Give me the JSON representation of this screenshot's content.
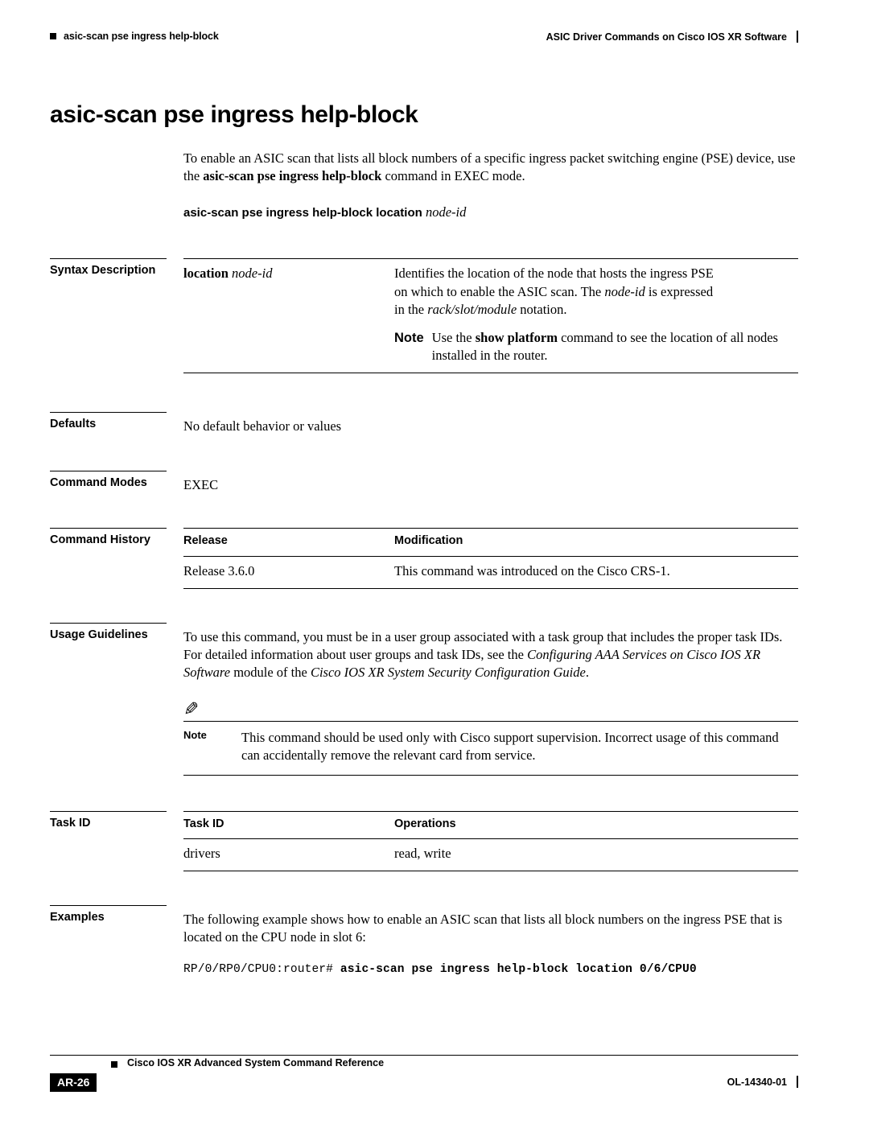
{
  "header": {
    "left_text": "asic-scan pse ingress help-block",
    "right_text": "ASIC Driver Commands on Cisco IOS XR Software"
  },
  "title": "asic-scan pse ingress help-block",
  "intro": {
    "part1": "To enable an ASIC scan that lists all block numbers of a specific ingress packet switching engine (PSE) device, use the ",
    "command_bold": "asic-scan pse ingress help-block",
    "part2": " command in EXEC mode."
  },
  "command_syntax": {
    "command": "asic-scan pse ingress help-block location",
    "argument": "node-id"
  },
  "sections": {
    "syntax_description": {
      "label": "Syntax Description",
      "param_bold": "location",
      "param_italic": "node-id",
      "desc_line1": "Identifies the location of the node that hosts the ingress PSE",
      "desc_line2_a": "on which to enable the ASIC scan. The ",
      "desc_line2_italic": "node-id",
      "desc_line2_b": " is expressed",
      "desc_line3_a": "in the ",
      "desc_line3_italic": "rack/slot/module",
      "desc_line3_b": " notation.",
      "note_label": "Note",
      "note_a": "Use the ",
      "note_bold": "show platform",
      "note_b": " command to see the location of all nodes installed in the router."
    },
    "defaults": {
      "label": "Defaults",
      "text": "No default behavior or values"
    },
    "command_modes": {
      "label": "Command Modes",
      "text": "EXEC"
    },
    "command_history": {
      "label": "Command History",
      "col1_header": "Release",
      "col2_header": "Modification",
      "rows": [
        {
          "release": "Release 3.6.0",
          "modification": "This command was introduced on the Cisco CRS-1."
        }
      ]
    },
    "usage_guidelines": {
      "label": "Usage Guidelines",
      "text_a": "To use this command, you must be in a user group associated with a task group that includes the proper task IDs. For detailed information about user groups and task IDs, see the ",
      "italic1": "Configuring AAA Services on Cisco IOS XR Software",
      "text_b": " module of the ",
      "italic2": "Cisco IOS XR System Security Configuration Guide",
      "text_c": ".",
      "note_label": "Note",
      "note_text": "This command should be used only with Cisco support supervision. Incorrect usage of this command can accidentally remove the relevant card from service."
    },
    "task_id": {
      "label": "Task ID",
      "col1_header": "Task ID",
      "col2_header": "Operations",
      "rows": [
        {
          "task": "drivers",
          "operations": "read, write"
        }
      ]
    },
    "examples": {
      "label": "Examples",
      "text": "The following example shows how to enable an ASIC scan that lists all block numbers on the ingress PSE that is located on the CPU node in slot 6:",
      "code_prompt": "RP/0/RP0/CPU0:router# ",
      "code_command": "asic-scan pse ingress help-block location 0/6/CPU0"
    }
  },
  "footer": {
    "book_title": "Cisco IOS XR Advanced System Command Reference",
    "page_number": "AR-26",
    "doc_number": "OL-14340-01"
  }
}
